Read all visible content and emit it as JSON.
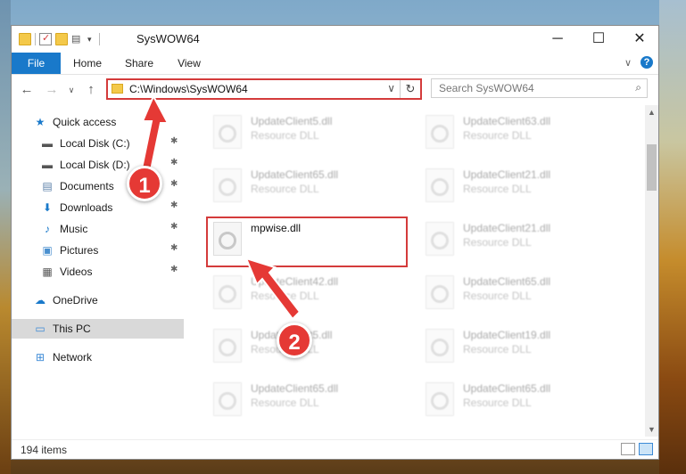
{
  "window": {
    "title": "SysWOW64",
    "controls": {
      "minimize": "─",
      "maximize": "☐",
      "close": "✕"
    }
  },
  "ribbon": {
    "tabs": [
      "File",
      "Home",
      "Share",
      "View"
    ],
    "chevron": "∨",
    "help": "?"
  },
  "nav": {
    "back": "←",
    "forward": "→",
    "recent": "∨",
    "up": "↑",
    "address": "C:\\Windows\\SysWOW64",
    "address_chevron": "∨",
    "refresh": "↻",
    "search_placeholder": "Search SysWOW64",
    "search_icon": "⌕"
  },
  "sidebar": {
    "items": [
      {
        "label": "Quick access",
        "icon": "star-icon",
        "glyph": "★",
        "color": "#1979ca"
      },
      {
        "label": "Local Disk (C:)",
        "icon": "drive-icon",
        "glyph": "▬",
        "color": "#555555",
        "pinned": true
      },
      {
        "label": "Local Disk (D:)",
        "icon": "drive-icon",
        "glyph": "▬",
        "color": "#555555",
        "pinned": true
      },
      {
        "label": "Documents",
        "icon": "documents-icon",
        "glyph": "▤",
        "color": "#5a7fa8",
        "pinned": true
      },
      {
        "label": "Downloads",
        "icon": "downloads-icon",
        "glyph": "⬇",
        "color": "#1979ca",
        "pinned": true
      },
      {
        "label": "Music",
        "icon": "music-icon",
        "glyph": "♪",
        "color": "#1979ca",
        "pinned": true
      },
      {
        "label": "Pictures",
        "icon": "pictures-icon",
        "glyph": "▣",
        "color": "#4a8fcf",
        "pinned": true
      },
      {
        "label": "Videos",
        "icon": "videos-icon",
        "glyph": "▦",
        "color": "#555555",
        "pinned": true
      },
      {
        "label": "OneDrive",
        "icon": "onedrive-icon",
        "glyph": "☁",
        "color": "#1979ca"
      },
      {
        "label": "This PC",
        "icon": "computer-icon",
        "glyph": "▭",
        "color": "#3c8ad6",
        "selected": true
      },
      {
        "label": "Network",
        "icon": "network-icon",
        "glyph": "⊞",
        "color": "#3c8ad6"
      }
    ],
    "pin_glyph": "📌"
  },
  "files": [
    {
      "name": "UpdateClient5.dll",
      "type": "Resource DLL"
    },
    {
      "name": "UpdateClient63.dll",
      "type": "Resource DLL"
    },
    {
      "name": "UpdateClient65.dll",
      "type": "Resource DLL"
    },
    {
      "name": "UpdateClient21.dll",
      "type": "Resource DLL"
    },
    {
      "name": "mpwise.dll",
      "type": ""
    },
    {
      "name": "UpdateClient21.dll",
      "type": "Resource DLL"
    },
    {
      "name": "UpdateClient42.dll",
      "type": "Resource DLL"
    },
    {
      "name": "UpdateClient65.dll",
      "type": "Resource DLL"
    },
    {
      "name": "UpdateClient5.dll",
      "type": "Resource DLL"
    },
    {
      "name": "UpdateClient19.dll",
      "type": "Resource DLL"
    },
    {
      "name": "UpdateClient65.dll",
      "type": "Resource DLL"
    },
    {
      "name": "UpdateClient65.dll",
      "type": "Resource DLL"
    }
  ],
  "status": {
    "count": "194 items"
  },
  "callouts": {
    "one": "1",
    "two": "2"
  },
  "colors": {
    "accent": "#1979ca",
    "highlight": "#d43b3b"
  }
}
